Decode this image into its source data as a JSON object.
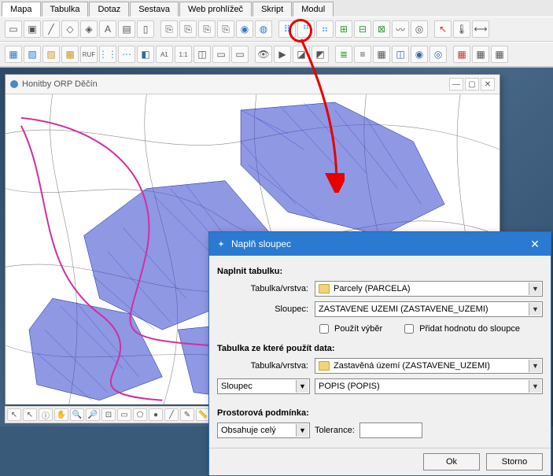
{
  "tabs": [
    "Mapa",
    "Tabulka",
    "Dotaz",
    "Sestava",
    "Web prohlížeč",
    "Skript",
    "Modul"
  ],
  "map_window": {
    "title": "Honitby ORP Děčín"
  },
  "dialog": {
    "title": "Naplň sloupec",
    "section1_label": "Naplnit tabulku:",
    "tab_vrstva_label": "Tabulka/vrstva:",
    "tab_vrstva_value": "Parcely (PARCELA)",
    "sloupec_label": "Sloupec:",
    "sloupec_value": "ZASTAVENE UZEMI (ZASTAVENE_UZEMI)",
    "chk1_label": "Použít výběr",
    "chk2_label": "Přidat hodnotu do sloupce",
    "section2_label": "Tabulka ze které použít data:",
    "src_tab_vrstva_value": "Zastavěná území (ZASTAVENE_UZEMI)",
    "src_sloupec_selector": "Sloupec",
    "src_sloupec_value": "POPIS (POPIS)",
    "section3_label": "Prostorová podmínka:",
    "spatial_select": "Obsahuje celý",
    "tolerance_label": "Tolerance:",
    "tolerance_value": "",
    "ok": "Ok",
    "cancel": "Storno"
  }
}
